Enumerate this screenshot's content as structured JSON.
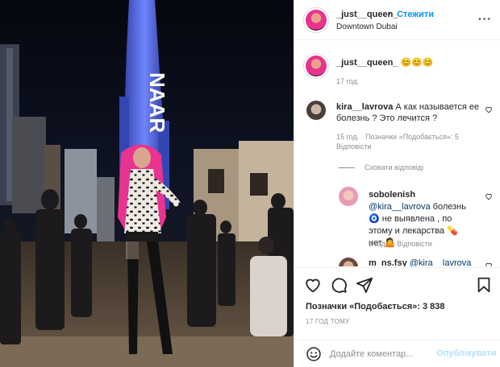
{
  "post": {
    "username": "_just__queen_",
    "separator": "•",
    "follow_label": "Стежити",
    "location": "Downtown Dubai",
    "more_icon": "more-options-icon",
    "caption_text": "😊😊😊",
    "caption_time": "17 год.",
    "photo_tower_text": "NAAR"
  },
  "comments": [
    {
      "username": "kira__lavrova",
      "text": "А как называется ее болезнь ? Это лечится ?",
      "time": "15 год.",
      "likes": "Позначки «Подобається»: 5",
      "reply": "Відповісти",
      "hide_replies": "Сховати відповіді",
      "replies": [
        {
          "username": "sobolenish",
          "mention": "@kira__lavrova",
          "text_a": "болезнь 🧿 не выявлена , по этому и лекарства 💊 нет 🤷",
          "time": "9 год.",
          "reply": "Відповісти"
        },
        {
          "username": "m_ns.fsy",
          "mention": "@kira__lavrova"
        }
      ]
    }
  ],
  "actions": {
    "like_icon": "heart-icon",
    "comment_icon": "comment-icon",
    "share_icon": "share-icon",
    "save_icon": "bookmark-icon",
    "likes_label": "Позначки «Подобається»: 3 838",
    "time_ago": "17 ГОД ТОМУ"
  },
  "add_comment": {
    "emoji_icon": "emoji-icon",
    "placeholder": "Додайте коментар...",
    "post_label": "Опублікувати"
  },
  "colors": {
    "accent": "#0095f6",
    "accent_disabled": "#b2dffc",
    "secondary_text": "#8e8e8e",
    "hair_pink": "#e8338f"
  }
}
